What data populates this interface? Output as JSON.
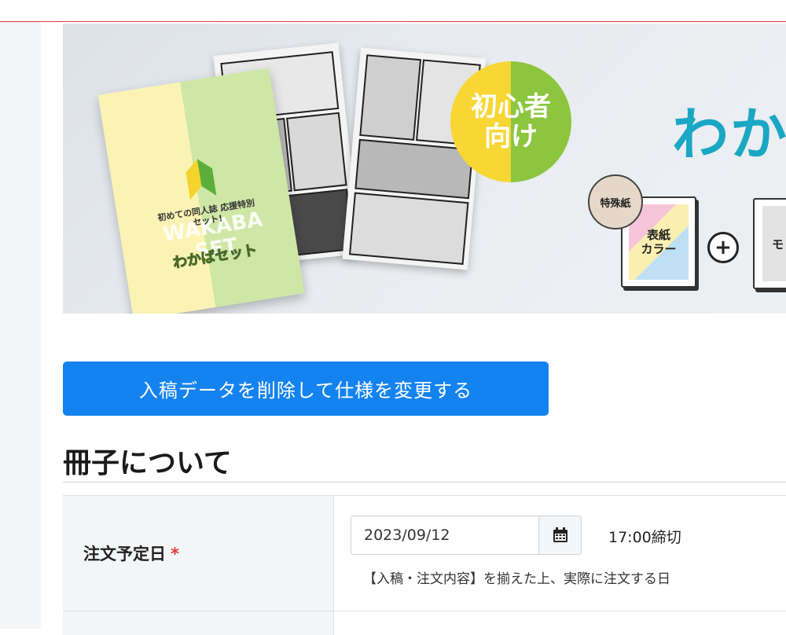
{
  "banner": {
    "beginner_badge_line1": "初心者",
    "beginner_badge_line2": "向け",
    "headline": "わか",
    "cover_subtitle": "初めての同人誌 応援特別セット!",
    "cover_title": "わかばセット",
    "cover_set_text": "WAKABA SET",
    "special_paper_badge": "特殊紙",
    "cover_icon_line1": "表紙",
    "cover_icon_line2": "カラー",
    "mono_icon_text": "モ",
    "colors": {
      "headline": "#1aa7c4",
      "badge_yellow": "#f8d634",
      "badge_green": "#8cc63f"
    }
  },
  "actions": {
    "respec_label": "入稿データを削除して仕様を変更する",
    "respec_color": "#1483f0"
  },
  "section": {
    "title": "冊子について"
  },
  "order_date": {
    "label": "注文予定日",
    "required_mark": "*",
    "value": "2023/09/12",
    "calendar_icon": "calendar-icon",
    "deadline": "17:00締切",
    "note": "【入稿・注文内容】を揃えた上、実際に注文する日"
  },
  "accent": {
    "top_border": "#d83a4b"
  }
}
